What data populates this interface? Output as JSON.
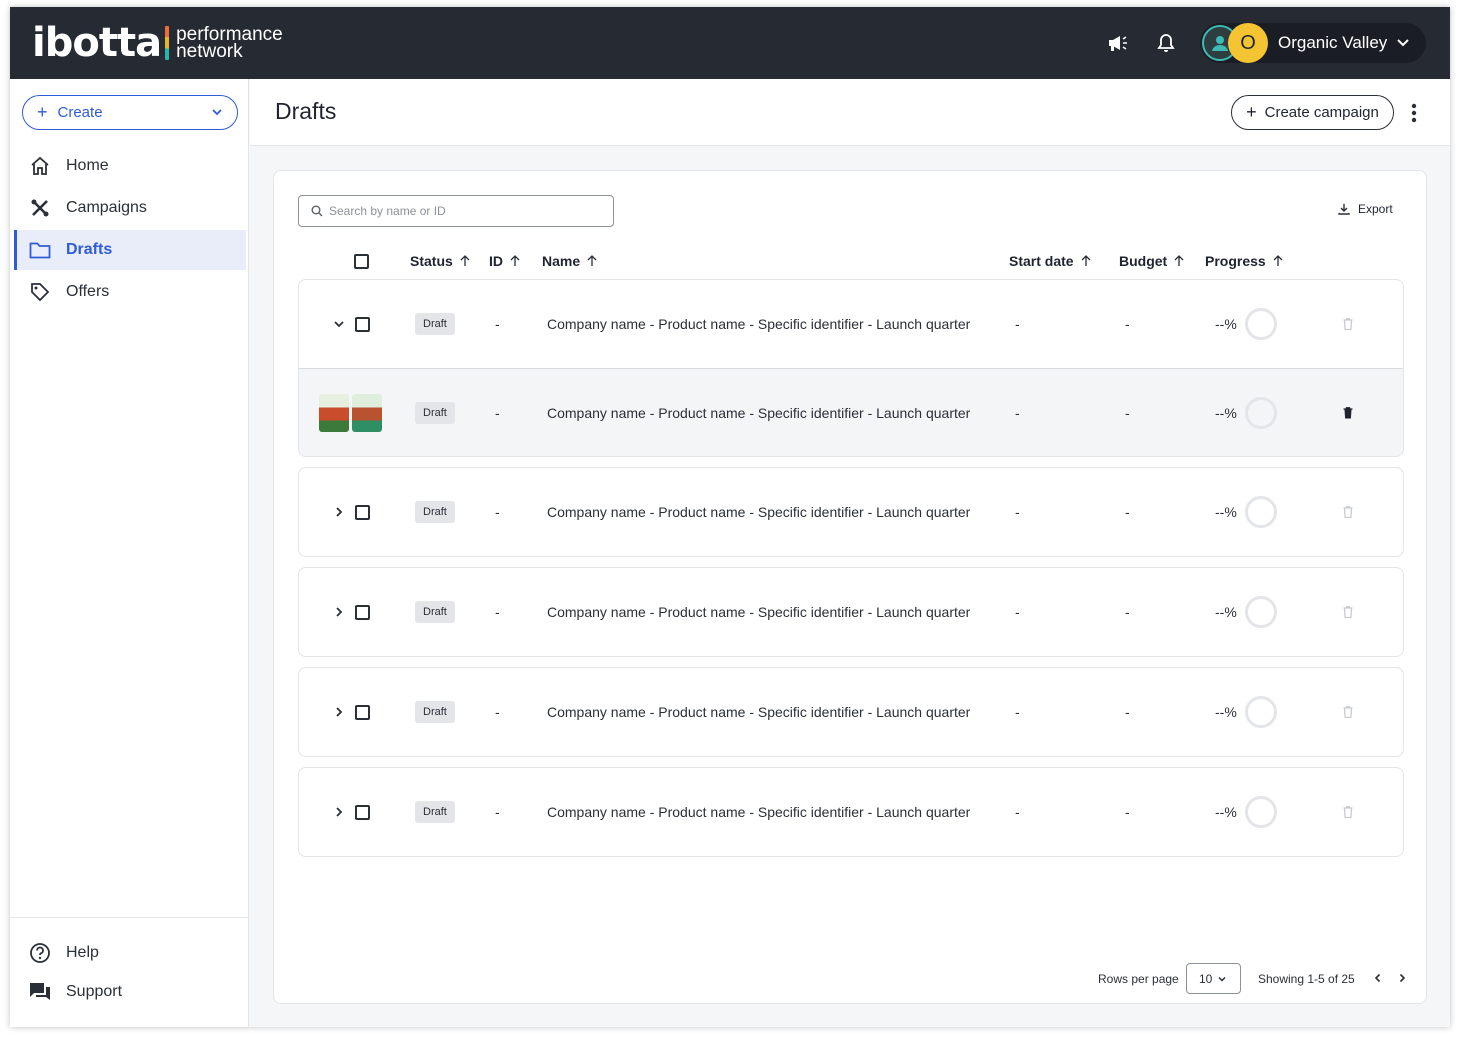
{
  "brand": {
    "logo_word": "ibotta",
    "logo_sub_1": "performance",
    "logo_sub_2": "network"
  },
  "topbar": {
    "account_initial": "O",
    "account_name": "Organic Valley"
  },
  "sidebar": {
    "create_label": "Create",
    "items": [
      {
        "label": "Home",
        "icon": "home-icon"
      },
      {
        "label": "Campaigns",
        "icon": "campaigns-icon"
      },
      {
        "label": "Drafts",
        "icon": "folder-icon",
        "active": true
      },
      {
        "label": "Offers",
        "icon": "tag-icon"
      }
    ],
    "help_label": "Help",
    "support_label": "Support"
  },
  "header": {
    "title": "Drafts",
    "create_campaign_label": "Create campaign"
  },
  "search": {
    "placeholder": "Search by name or ID"
  },
  "export_label": "Export",
  "table": {
    "columns": [
      "Status",
      "ID",
      "Name",
      "Start date",
      "Budget",
      "Progress"
    ],
    "rows": [
      {
        "status": "Draft",
        "id": "-",
        "name": "Company name - Product name - Specific identifier - Launch quarter",
        "start_date": "-",
        "budget": "-",
        "progress": "--%"
      },
      {
        "status": "Draft",
        "id": "-",
        "name": "Company name - Product name - Specific identifier - Launch quarter",
        "start_date": "-",
        "budget": "-",
        "progress": "--%"
      },
      {
        "status": "Draft",
        "id": "-",
        "name": "Company name - Product name - Specific identifier - Launch quarter",
        "start_date": "-",
        "budget": "-",
        "progress": "--%"
      },
      {
        "status": "Draft",
        "id": "-",
        "name": "Company name - Product name - Specific identifier - Launch quarter",
        "start_date": "-",
        "budget": "-",
        "progress": "--%"
      },
      {
        "status": "Draft",
        "id": "-",
        "name": "Company name - Product name - Specific identifier - Launch quarter",
        "start_date": "-",
        "budget": "-",
        "progress": "--%"
      }
    ],
    "expanded_sub_row": {
      "status": "Draft",
      "id": "-",
      "name": "Company name - Product name - Specific identifier - Launch quarter",
      "start_date": "-",
      "budget": "-",
      "progress": "--%"
    }
  },
  "pagination": {
    "rows_per_page_label": "Rows per page",
    "rows_per_page_value": "10",
    "showing_text": "Showing 1-5 of 25"
  },
  "colors": {
    "accent": "#2f5bd6",
    "topbar": "#262b33",
    "avatar_yellow": "#f4c432",
    "avatar_teal": "#3bbbb4"
  }
}
